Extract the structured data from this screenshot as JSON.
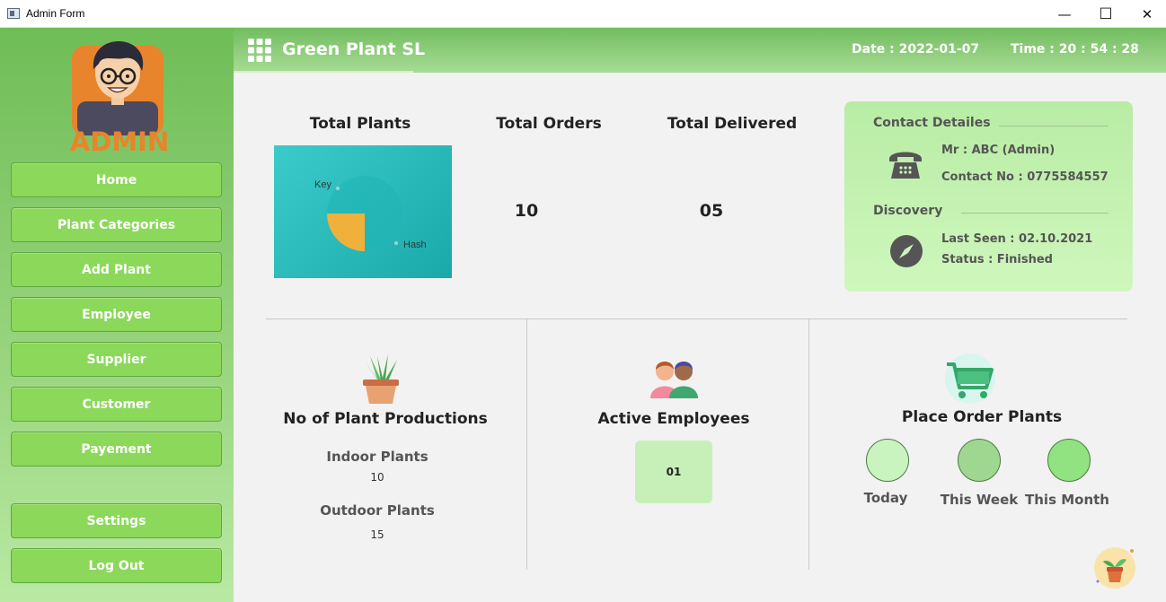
{
  "window": {
    "title": "Admin Form",
    "minimize": "—",
    "maximize": "☐",
    "close": "✕"
  },
  "sidebar": {
    "logo_text": "ADMIN",
    "nav": [
      {
        "label": "Home"
      },
      {
        "label": "Plant Categories"
      },
      {
        "label": "Add Plant"
      },
      {
        "label": "Employee"
      },
      {
        "label": "Supplier"
      },
      {
        "label": "Customer"
      },
      {
        "label": "Payement"
      },
      {
        "label": "Settings"
      },
      {
        "label": "Log Out"
      }
    ]
  },
  "header": {
    "brand": "Green Plant SL",
    "date": "Date  : 2022-01-07",
    "time": "Time  : 20 : 54 : 28"
  },
  "stats": {
    "total_plants": {
      "title": "Total Plants"
    },
    "total_orders": {
      "title": "Total Orders",
      "value": "10"
    },
    "total_delivered": {
      "title": "Total Delivered",
      "value": "05"
    }
  },
  "chart_data": {
    "type": "pie",
    "slices": [
      {
        "label": "Key",
        "value": 75
      },
      {
        "label": "Hash",
        "value": 25
      }
    ],
    "colors": {
      "Key": "#1fb5b5",
      "Hash": "#f0b13a"
    }
  },
  "contact": {
    "contact_heading": "Contact Detailes",
    "name": "Mr : ABC  (Admin)",
    "phone": "Contact No : 0775584557",
    "discovery_heading": "Discovery",
    "last_seen": "Last Seen : 02.10.2021",
    "status": "Status : Finished"
  },
  "productions": {
    "title": "No of Plant Productions",
    "indoor_label": "Indoor Plants",
    "indoor_value": "10",
    "outdoor_label": "Outdoor Plants",
    "outdoor_value": "15"
  },
  "employees": {
    "title": "Active Employees",
    "value": "01"
  },
  "orders": {
    "title": "Place Order Plants",
    "today": "Today",
    "this_week": "This Week",
    "this_month": "This Month"
  },
  "colors": {
    "sidebar_top": "#6fbd57",
    "nav_button": "#8bd85a",
    "header": "#72bd5f",
    "contact_panel": "#c4f2b0",
    "today_circle": "#c9f4bf",
    "week_circle": "#9fd690",
    "month_circle": "#90e380"
  }
}
